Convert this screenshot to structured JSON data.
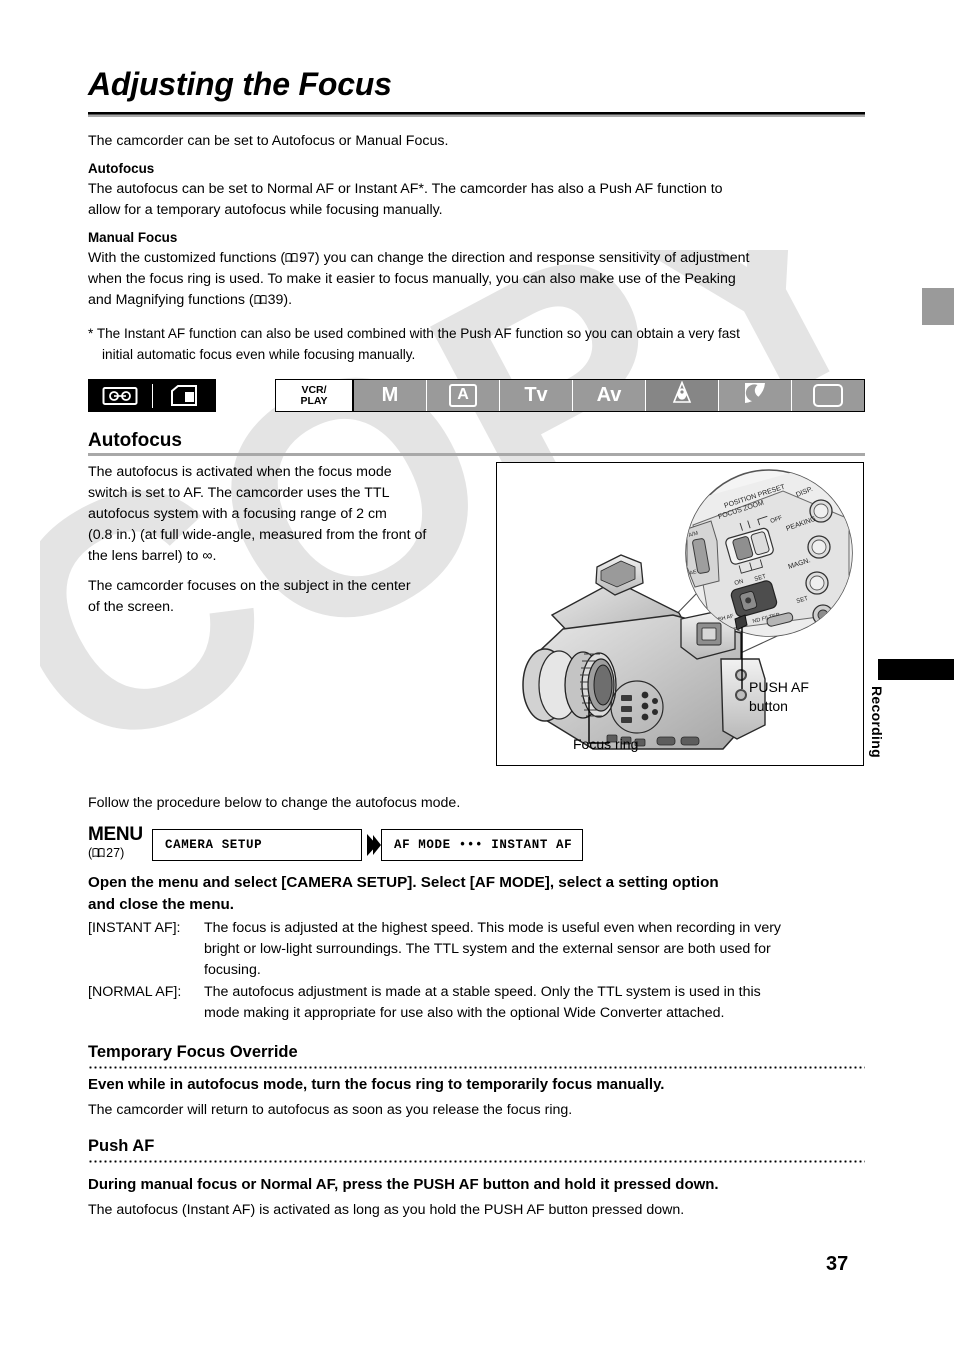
{
  "page": {
    "title": "Adjusting the Focus",
    "number": "37",
    "side_tab": "Recording",
    "watermark": "COPY"
  },
  "intro": {
    "lead": "The camcorder can be set to Autofocus or Manual Focus."
  },
  "autofocus_block": {
    "heading": "Autofocus",
    "line1": "The autofocus can be set to Normal AF or Instant AF*. The camcorder has also a Push AF function to",
    "line2": "allow for a temporary autofocus while focusing manually."
  },
  "manual_focus_block": {
    "heading": "Manual Focus",
    "line1_a": "With the customized functions (",
    "line1_ref": "97",
    "line1_b": ") you can change the direction and response sensitivity of adjustment",
    "line2": "when the focus ring is used. To make it easier to focus manually, you can also make use of the Peaking",
    "line3_a": "and Magnifying functions (",
    "line3_ref": "39",
    "line3_b": ")."
  },
  "footnote": {
    "line1": "* The Instant AF function can also be used combined with the Push AF function so you can obtain a very fast",
    "line2": "initial automatic focus even while focusing manually."
  },
  "mode_bar": {
    "media_icons": [
      {
        "name": "cassette-tape-icon",
        "label": "tape"
      },
      {
        "name": "memory-card-icon",
        "label": "card"
      }
    ],
    "cells": [
      {
        "label": "VCR/\nPLAY",
        "line1": "VCR/",
        "line2": "PLAY",
        "style": "vcr",
        "active": false
      },
      {
        "label": "M",
        "style": "plain",
        "active": true
      },
      {
        "label": "A",
        "style": "boxed",
        "active": true
      },
      {
        "label": "Tv",
        "style": "plain",
        "active": true
      },
      {
        "label": "Av",
        "style": "plain",
        "active": true
      },
      {
        "label": "spotlight",
        "style": "icon-spotlight",
        "active": true
      },
      {
        "label": "night",
        "style": "icon-moon",
        "active": true
      },
      {
        "label": "card-rec",
        "style": "icon-rect",
        "active": true
      }
    ]
  },
  "autofocus_section": {
    "heading": "Autofocus",
    "body": [
      "The autofocus is activated when the focus mode",
      "switch is set to AF. The camcorder uses the TTL",
      "autofocus system with a focusing range of 2 cm",
      "(0.8 in.) (at full wide-angle, measured from the front of",
      "the lens barrel) to ∞."
    ],
    "body2": [
      "The camcorder focuses on the subject in the center",
      "of the screen."
    ]
  },
  "illustration": {
    "callouts": [
      {
        "name": "push-af-button",
        "line1": "PUSH AF",
        "line2": "button"
      },
      {
        "name": "focus-ring",
        "line1": "Focus ring"
      }
    ],
    "detail_labels": [
      "POSITION PRESET",
      "FOCUS ZOOM",
      "OFF",
      "ON",
      "SET",
      "DISP.",
      "PEAKING",
      "MAGN."
    ]
  },
  "procedure": {
    "intro": "Follow the procedure below to change the autofocus mode.",
    "menu_word": "MENU",
    "menu_ref": "27",
    "boxes": [
      {
        "text": "CAMERA SETUP"
      },
      {
        "text": "AF MODE ••• INSTANT AF"
      }
    ],
    "instruction_line1": "Open the menu and select [CAMERA SETUP]. Select [AF MODE], select a setting option",
    "instruction_line2": "and close the menu."
  },
  "af_options": [
    {
      "term": "[INSTANT AF]:",
      "lines": [
        "The focus is adjusted at the highest speed. This mode is useful even when recording in very",
        "bright or low-light surroundings. The TTL system and the external sensor are both used for",
        "focusing."
      ]
    },
    {
      "term": "[NORMAL AF]:",
      "lines": [
        "The autofocus adjustment is made at a stable speed. Only the TTL system is used in this",
        "mode making it appropriate for use also with the optional Wide Converter attached."
      ]
    }
  ],
  "override_section": {
    "heading": "Temporary Focus Override",
    "bold_line": "Even while in autofocus mode, turn the focus ring to temporarily focus manually.",
    "body": "The camcorder will return to autofocus as soon as you release the focus ring."
  },
  "push_af_section": {
    "heading": "Push AF",
    "bold_line": "During manual focus or Normal AF, press the PUSH AF button and hold it pressed down.",
    "body": "The autofocus (Instant AF) is activated as long as you hold the PUSH AF button pressed down."
  },
  "colors": {
    "mode_gray": "#9a9a9a",
    "mode_dark_gray": "#868686",
    "rule_gray": "#a8a8a8",
    "black": "#000000",
    "watermark_gray": "#e2e2e2"
  }
}
